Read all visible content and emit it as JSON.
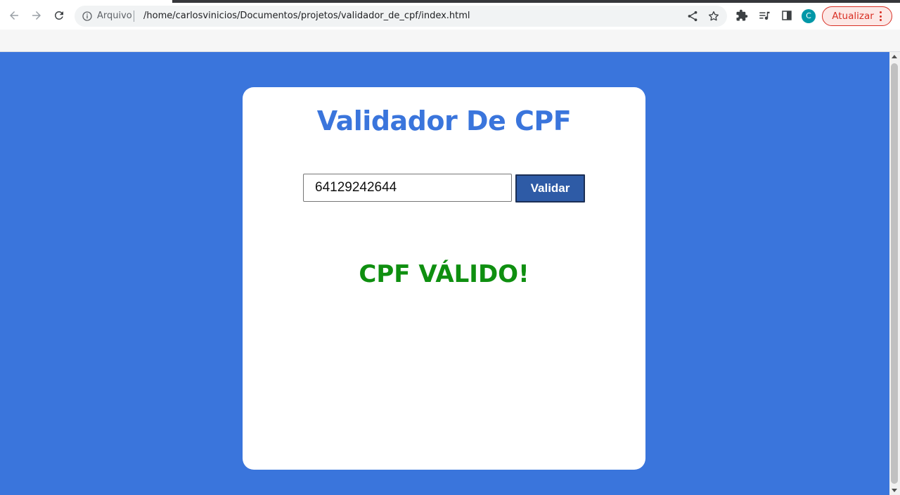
{
  "browser": {
    "security_chip": "Arquivo",
    "url": "/home/carlosvinicios/Documentos/projetos/validador_de_cpf/index.html",
    "profile_initial": "C",
    "update_button_label": "Atualizar",
    "icons": [
      "back-icon",
      "forward-icon",
      "reload-icon",
      "info-icon",
      "share-icon",
      "star-icon",
      "extensions-icon",
      "reading-list-icon",
      "side-panel-icon",
      "menu-dots-icon"
    ]
  },
  "page": {
    "background_color": "#3a75dc",
    "title": "Validador De CPF",
    "cpf_input_value": "64129242644",
    "validate_button_label": "Validar",
    "result_text": "CPF VÁLIDO!",
    "result_color": "#0f8f10"
  }
}
